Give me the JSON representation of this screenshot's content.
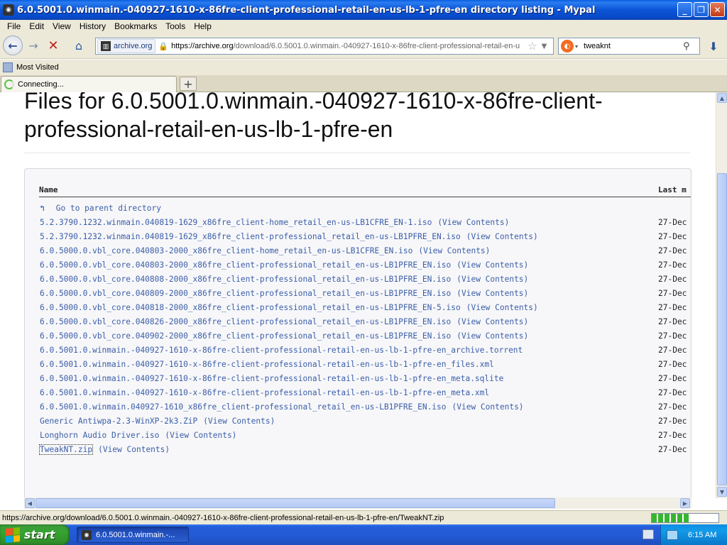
{
  "window": {
    "title": "6.0.5001.0.winmain.-040927-1610-x-86fre-client-professional-retail-en-us-lb-1-pfre-en directory listing - Mypal",
    "minimize": "_",
    "maximize": "❐",
    "close": "✕"
  },
  "menu": {
    "items": [
      {
        "label": "File"
      },
      {
        "label": "Edit"
      },
      {
        "label": "View"
      },
      {
        "label": "History"
      },
      {
        "label": "Bookmarks"
      },
      {
        "label": "Tools"
      },
      {
        "label": "Help"
      }
    ]
  },
  "navbar": {
    "site_identity": "archive.org",
    "url_scheme_host": "https://archive.org",
    "url_path": "/download/6.0.5001.0.winmain.-040927-1610-x-86fre-client-professional-retail-en-u",
    "search_value": "tweaknt",
    "icons": {
      "back": "back-arrow-icon",
      "forward": "forward-arrow-icon",
      "stop": "stop-x-icon",
      "home": "home-icon",
      "bookmark": "star-icon",
      "search": "magnifier-icon",
      "downloads": "download-arrow-icon"
    }
  },
  "bookmarks": {
    "items": [
      {
        "label": "Most Visited"
      }
    ]
  },
  "tabs": [
    {
      "label": "Connecting...",
      "loading": true
    }
  ],
  "page": {
    "title": "Files for 6.0.5001.0.winmain.-040927-1610-x-86fre-client-professional-retail-en-us-lb-1-pfre-en",
    "columns": {
      "name": "Name",
      "modified": "Last m"
    },
    "parent_link": "Go to parent directory",
    "rows": [
      {
        "name": "5.2.3790.1232.winmain.040819-1629_x86fre_client-home_retail_en-us-LB1CFRE_EN-1.iso",
        "view": "(View Contents)",
        "date": "27-Dec"
      },
      {
        "name": "5.2.3790.1232.winmain.040819-1629_x86fre_client-professional_retail_en-us-LB1PFRE_EN.iso",
        "view": "(View Contents)",
        "date": "27-Dec"
      },
      {
        "name": "6.0.5000.0.vbl_core.040803-2000_x86fre_client-home_retail_en-us-LB1CFRE_EN.iso",
        "view": "(View Contents)",
        "date": "27-Dec"
      },
      {
        "name": "6.0.5000.0.vbl_core.040803-2000_x86fre_client-professional_retail_en-us-LB1PFRE_EN.iso",
        "view": "(View Contents)",
        "date": "27-Dec"
      },
      {
        "name": "6.0.5000.0.vbl_core.040808-2000_x86fre_client-professional_retail_en-us-LB1PFRE_EN.iso",
        "view": "(View Contents)",
        "date": "27-Dec"
      },
      {
        "name": "6.0.5000.0.vbl_core.040809-2000_x86fre_client-professional_retail_en-us-LB1PFRE_EN.iso",
        "view": "(View Contents)",
        "date": "27-Dec"
      },
      {
        "name": "6.0.5000.0.vbl_core.040818-2000_x86fre_client-professional_retail_en-us-LB1PFRE_EN-5.iso",
        "view": "(View Contents)",
        "date": "27-Dec"
      },
      {
        "name": "6.0.5000.0.vbl_core.040826-2000_x86fre_client-professional_retail_en-us-LB1PFRE_EN.iso",
        "view": "(View Contents)",
        "date": "27-Dec"
      },
      {
        "name": "6.0.5000.0.vbl_core.040902-2000_x86fre_client-professional_retail_en-us-LB1PFRE_EN.iso",
        "view": "(View Contents)",
        "date": "27-Dec"
      },
      {
        "name": "6.0.5001.0.winmain.-040927-1610-x-86fre-client-professional-retail-en-us-lb-1-pfre-en_archive.torrent",
        "view": "",
        "date": "27-Dec"
      },
      {
        "name": "6.0.5001.0.winmain.-040927-1610-x-86fre-client-professional-retail-en-us-lb-1-pfre-en_files.xml",
        "view": "",
        "date": "27-Dec"
      },
      {
        "name": "6.0.5001.0.winmain.-040927-1610-x-86fre-client-professional-retail-en-us-lb-1-pfre-en_meta.sqlite",
        "view": "",
        "date": "27-Dec"
      },
      {
        "name": "6.0.5001.0.winmain.-040927-1610-x-86fre-client-professional-retail-en-us-lb-1-pfre-en_meta.xml",
        "view": "",
        "date": "27-Dec"
      },
      {
        "name": "6.0.5001.0.winmain.040927-1610_x86fre_client-professional_retail_en-us-LB1PFRE_EN.iso",
        "view": "(View Contents)",
        "date": "27-Dec"
      },
      {
        "name": "Generic Antiwpa-2.3-WinXP-2k3.ZiP",
        "view": "(View Contents)",
        "date": "27-Dec"
      },
      {
        "name": "Longhorn Audio Driver.iso",
        "view": "(View Contents)",
        "date": "27-Dec"
      },
      {
        "name": "TweakNT.zip",
        "view": "(View Contents)",
        "date": "27-Dec",
        "focused": true
      }
    ]
  },
  "status": {
    "text": "https://archive.org/download/6.0.5001.0.winmain.-040927-1610-x-86fre-client-professional-retail-en-us-lb-1-pfre-en/TweakNT.zip",
    "progress_percent": 55
  },
  "taskbar": {
    "start_label": "start",
    "task_label": "6.0.5001.0.winmain.-...",
    "clock": "6:15 AM"
  },
  "colors": {
    "link": "#3b5ea8",
    "titlebar": "#0b54d6",
    "chrome": "#ece9d8",
    "start_green": "#36a331"
  }
}
